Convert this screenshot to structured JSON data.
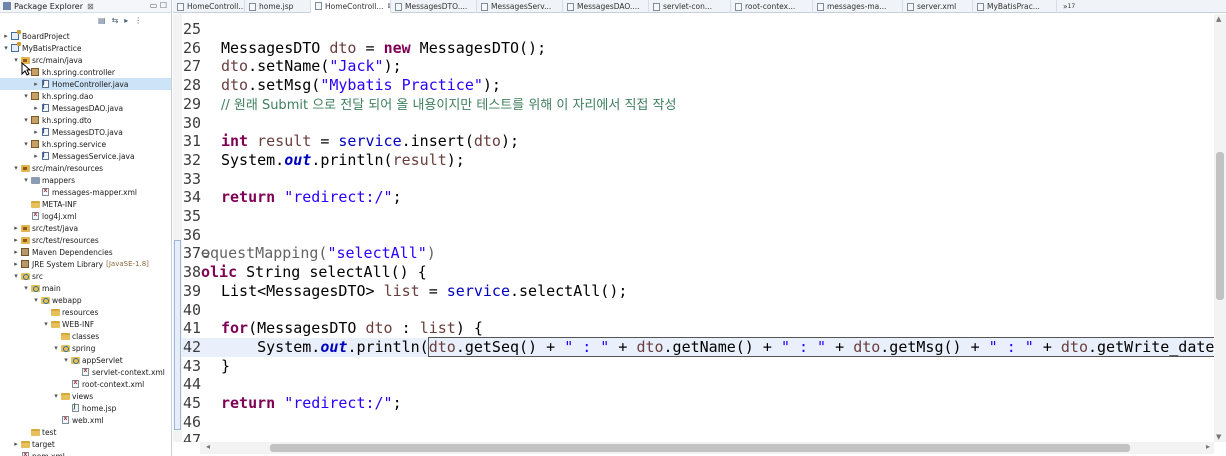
{
  "explorer": {
    "title": "Package Explorer",
    "close_glyph": "⊠",
    "minimize_glyph": "▭ ☐",
    "toolbar_glyphs": [
      "▤",
      "⇆",
      "▸",
      "⋮"
    ],
    "tree": [
      {
        "label": "BoardProject",
        "icon": "project",
        "arrow": "▸",
        "indent": 0
      },
      {
        "label": "MyBatisPractice",
        "icon": "project",
        "arrow": "▾",
        "indent": 0
      },
      {
        "label": "src/main/java",
        "icon": "srcfolder",
        "arrow": "▾",
        "indent": 1
      },
      {
        "label": "kh.spring.controller",
        "icon": "package",
        "arrow": "▾",
        "indent": 2
      },
      {
        "label": "HomeController.java",
        "icon": "java",
        "arrow": "▸",
        "indent": 3,
        "selected": true
      },
      {
        "label": "kh.spring.dao",
        "icon": "package",
        "arrow": "▾",
        "indent": 2
      },
      {
        "label": "MessagesDAO.java",
        "icon": "java",
        "arrow": "▸",
        "indent": 3
      },
      {
        "label": "kh.spring.dto",
        "icon": "package",
        "arrow": "▾",
        "indent": 2
      },
      {
        "label": "MessagesDTO.java",
        "icon": "java",
        "arrow": "▸",
        "indent": 3
      },
      {
        "label": "kh.spring.service",
        "icon": "package",
        "arrow": "▾",
        "indent": 2
      },
      {
        "label": "MessagesService.java",
        "icon": "java",
        "arrow": "▸",
        "indent": 3
      },
      {
        "label": "src/main/resources",
        "icon": "srcfolder",
        "arrow": "▾",
        "indent": 1
      },
      {
        "label": "mappers",
        "icon": "mapfolder",
        "arrow": "▾",
        "indent": 2
      },
      {
        "label": "messages-mapper.xml",
        "icon": "xml",
        "arrow": "",
        "indent": 3
      },
      {
        "label": "META-INF",
        "icon": "folder",
        "arrow": "",
        "indent": 2
      },
      {
        "label": "log4j.xml",
        "icon": "xml",
        "arrow": "",
        "indent": 2
      },
      {
        "label": "src/test/java",
        "icon": "srcfolder",
        "arrow": "▸",
        "indent": 1
      },
      {
        "label": "src/test/resources",
        "icon": "srcfolder",
        "arrow": "▸",
        "indent": 1
      },
      {
        "label": "Maven Dependencies",
        "icon": "library",
        "arrow": "▸",
        "indent": 1
      },
      {
        "label": "JRE System Library",
        "sub": "[JavaSE-1.8]",
        "icon": "library",
        "arrow": "▸",
        "indent": 1
      },
      {
        "label": "src",
        "icon": "webapp",
        "arrow": "▾",
        "indent": 1
      },
      {
        "label": "main",
        "icon": "webapp",
        "arrow": "▾",
        "indent": 2
      },
      {
        "label": "webapp",
        "icon": "webapp",
        "arrow": "▾",
        "indent": 3
      },
      {
        "label": "resources",
        "icon": "folder",
        "arrow": "",
        "indent": 4
      },
      {
        "label": "WEB-INF",
        "icon": "folder",
        "arrow": "▾",
        "indent": 4
      },
      {
        "label": "classes",
        "icon": "folder",
        "arrow": "",
        "indent": 5
      },
      {
        "label": "spring",
        "icon": "webapp",
        "arrow": "▾",
        "indent": 5
      },
      {
        "label": "appServlet",
        "icon": "webapp",
        "arrow": "▾",
        "indent": 6
      },
      {
        "label": "servlet-context.xml",
        "icon": "xml",
        "arrow": "",
        "indent": 7
      },
      {
        "label": "root-context.xml",
        "icon": "xml",
        "arrow": "",
        "indent": 6
      },
      {
        "label": "views",
        "icon": "folder",
        "arrow": "▾",
        "indent": 5
      },
      {
        "label": "home.jsp",
        "icon": "jsp",
        "arrow": "",
        "indent": 6
      },
      {
        "label": "web.xml",
        "icon": "xml",
        "arrow": "",
        "indent": 5
      },
      {
        "label": "test",
        "icon": "folder",
        "arrow": "",
        "indent": 2
      },
      {
        "label": "target",
        "icon": "folder",
        "arrow": "▸",
        "indent": 1
      },
      {
        "label": "pom.xml",
        "icon": "xml",
        "arrow": "",
        "indent": 1
      }
    ]
  },
  "tabs": [
    {
      "label": "HomeControll...",
      "active": false
    },
    {
      "label": "home.jsp",
      "active": false
    },
    {
      "label": "HomeControll...",
      "active": true,
      "close": "⊠"
    },
    {
      "label": "MessagesDTO....",
      "active": false
    },
    {
      "label": "MessagesServ...",
      "active": false
    },
    {
      "label": "MessagesDAO....",
      "active": false
    },
    {
      "label": "servlet-con...",
      "active": false
    },
    {
      "label": "root-contex...",
      "active": false
    },
    {
      "label": "messages-ma...",
      "active": false
    },
    {
      "label": "server.xml",
      "active": false
    },
    {
      "label": "MyBatisPrac...",
      "active": false
    }
  ],
  "tab_overflow": "»",
  "tab_overflow_count": "17",
  "editor": {
    "lines": [
      {
        "n": "25",
        "tokens": []
      },
      {
        "n": "26",
        "tokens": [
          [
            "",
            "MessagesDTO "
          ],
          [
            "var",
            "dto"
          ],
          [
            "",
            " = "
          ],
          [
            "kw",
            "new"
          ],
          [
            "",
            " MessagesDTO();"
          ]
        ]
      },
      {
        "n": "27",
        "tokens": [
          [
            "var",
            "dto"
          ],
          [
            "",
            ".setName("
          ],
          [
            "str",
            "\"Jack\""
          ],
          [
            "",
            ");"
          ]
        ]
      },
      {
        "n": "28",
        "tokens": [
          [
            "var",
            "dto"
          ],
          [
            "",
            ".setMsg("
          ],
          [
            "str",
            "\"Mybatis Practice\""
          ],
          [
            "",
            ");"
          ]
        ]
      },
      {
        "n": "29",
        "tokens": [
          [
            "com",
            "// 원래 Submit 으로 전달 되어 올 내용이지만 테스트를 위해 이 자리에서 직접 작성"
          ]
        ]
      },
      {
        "n": "30",
        "tokens": []
      },
      {
        "n": "31",
        "tokens": [
          [
            "kw",
            "int"
          ],
          [
            "",
            " "
          ],
          [
            "var",
            "result"
          ],
          [
            "",
            " = "
          ],
          [
            "svc",
            "service"
          ],
          [
            "",
            ".insert("
          ],
          [
            "var",
            "dto"
          ],
          [
            "",
            ");"
          ]
        ]
      },
      {
        "n": "32",
        "tokens": [
          [
            "",
            "System."
          ],
          [
            "field",
            "out"
          ],
          [
            "",
            ".println("
          ],
          [
            "var",
            "result"
          ],
          [
            "",
            ");"
          ]
        ]
      },
      {
        "n": "33",
        "tokens": []
      },
      {
        "n": "34",
        "tokens": [
          [
            "kw",
            "return"
          ],
          [
            "",
            " "
          ],
          [
            "str",
            "\"redirect:/\""
          ],
          [
            "",
            ";"
          ]
        ]
      },
      {
        "n": "35",
        "tokens": []
      },
      {
        "n": "36",
        "tokens": []
      },
      {
        "n": "37⊖",
        "clipped": true,
        "tokens": [
          [
            "ann",
            "equestMapping("
          ],
          [
            "str",
            "\"selectAll\""
          ],
          [
            "ann",
            ")"
          ]
        ]
      },
      {
        "n": "38",
        "clipped": true,
        "tokens": [
          [
            "kw",
            "olic"
          ],
          [
            "",
            " String selectAll() {"
          ]
        ]
      },
      {
        "n": "39",
        "tokens": [
          [
            "",
            "List<MessagesDTO> "
          ],
          [
            "var",
            "list"
          ],
          [
            "",
            " = "
          ],
          [
            "svc",
            "service"
          ],
          [
            "",
            ".selectAll();"
          ]
        ]
      },
      {
        "n": "40",
        "tokens": []
      },
      {
        "n": "41",
        "tokens": [
          [
            "kw",
            "for"
          ],
          [
            "",
            "(MessagesDTO "
          ],
          [
            "var",
            "dto"
          ],
          [
            "",
            " : "
          ],
          [
            "var",
            "list"
          ],
          [
            "",
            ") {"
          ]
        ]
      },
      {
        "n": "42",
        "current": true,
        "tokens": [
          [
            "",
            "    System."
          ],
          [
            "field",
            "out"
          ],
          [
            "",
            ".println("
          ],
          [
            "selvar",
            "dto"
          ],
          [
            "sel",
            ".getSeq() + "
          ],
          [
            "selstr",
            "\" : \""
          ],
          [
            "sel",
            " + "
          ],
          [
            "selvar",
            "dto"
          ],
          [
            "sel",
            ".getName() + "
          ],
          [
            "selstr",
            "\" : \""
          ],
          [
            "sel",
            " + "
          ],
          [
            "selvar",
            "dto"
          ],
          [
            "sel",
            ".getMsg() + "
          ],
          [
            "selstr",
            "\" : \""
          ],
          [
            "sel",
            " + "
          ],
          [
            "selvar",
            "dto"
          ],
          [
            "sel",
            ".getWrite_date()"
          ],
          [
            "",
            ");"
          ]
        ]
      },
      {
        "n": "43",
        "tokens": [
          [
            "",
            "}"
          ]
        ]
      },
      {
        "n": "44",
        "tokens": []
      },
      {
        "n": "45",
        "tokens": [
          [
            "kw",
            "return"
          ],
          [
            "",
            " "
          ],
          [
            "str",
            "\"redirect:/\""
          ],
          [
            "",
            ";"
          ]
        ]
      },
      {
        "n": "46",
        "tokens": []
      },
      {
        "n": "47",
        "tokens": []
      }
    ]
  },
  "colors": {
    "keyword": "#7f0055",
    "string": "#2a00ff",
    "variable": "#6a3e3e",
    "field": "#0000c0",
    "comment": "#3f7f5f",
    "current_line": "#e9f0fb",
    "selection_tree": "#cde3f7"
  }
}
